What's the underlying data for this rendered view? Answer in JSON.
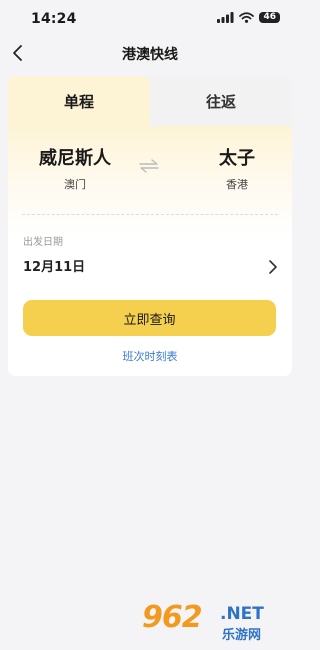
{
  "status_bar": {
    "time": "14:24",
    "battery": "46"
  },
  "nav": {
    "title": "港澳快线"
  },
  "tabs": [
    {
      "label": "单程",
      "active": true
    },
    {
      "label": "往返",
      "active": false
    }
  ],
  "route": {
    "from": {
      "station": "威尼斯人",
      "city": "澳门"
    },
    "to": {
      "station": "太子",
      "city": "香港"
    }
  },
  "date": {
    "label": "出发日期",
    "value": "12月11日"
  },
  "actions": {
    "query_label": "立即查询",
    "timetable_label": "班次时刻表"
  },
  "watermark": {
    "brand": "962",
    "domain": ".NET",
    "subtitle": "乐游网"
  },
  "colors": {
    "accent": "#f5d04e",
    "link": "#3a7bd5",
    "background": "#f4f4f6"
  }
}
